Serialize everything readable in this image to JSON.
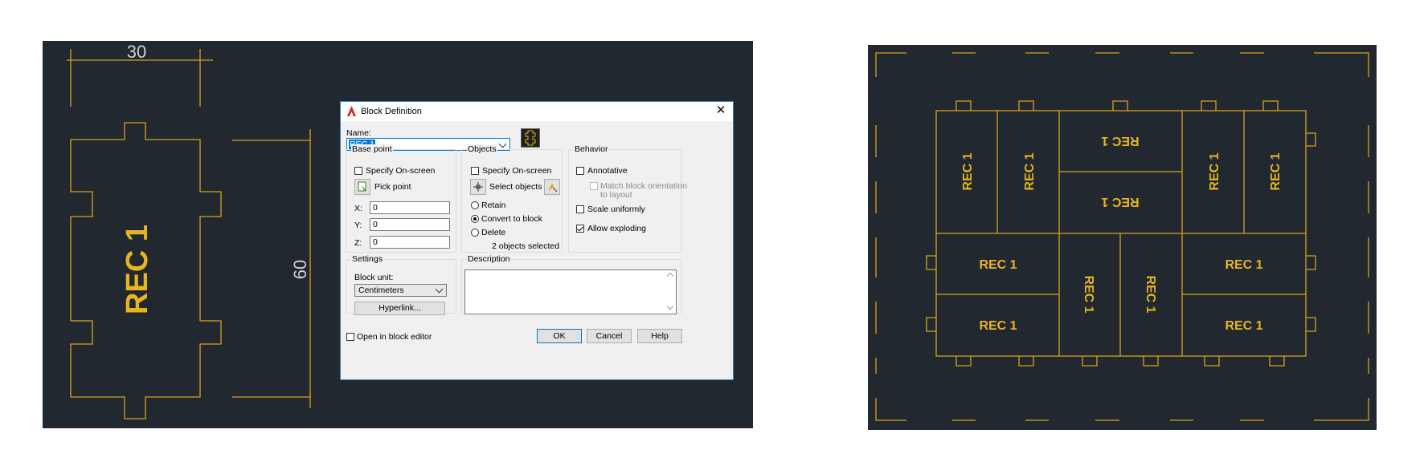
{
  "drawing_left": {
    "dim_width": "30",
    "dim_height": "60",
    "block_label": "REC 1"
  },
  "drawing_right": {
    "block_label": "REC 1"
  },
  "dialog": {
    "title": "Block Definition",
    "name_label": "Name:",
    "name_value": "REC 1",
    "base_point": {
      "title": "Base point",
      "specify_onscreen": "Specify On-screen",
      "pick_point": "Pick point",
      "x_label": "X:",
      "x_value": "0",
      "y_label": "Y:",
      "y_value": "0",
      "z_label": "Z:",
      "z_value": "0"
    },
    "objects": {
      "title": "Objects",
      "specify_onscreen": "Specify On-screen",
      "select_objects": "Select objects",
      "retain": "Retain",
      "convert": "Convert to block",
      "delete": "Delete",
      "selected_count": "2 objects selected"
    },
    "behavior": {
      "title": "Behavior",
      "annotative": "Annotative",
      "match_orientation_1": "Match block orientation",
      "match_orientation_2": "to layout",
      "scale_uniformly": "Scale uniformly",
      "allow_exploding": "Allow exploding"
    },
    "settings": {
      "title": "Settings",
      "block_unit_label": "Block unit:",
      "block_unit_value": "Centimeters",
      "hyperlink": "Hyperlink..."
    },
    "description": {
      "title": "Description",
      "value": ""
    },
    "open_in_editor": "Open in block editor",
    "ok": "OK",
    "cancel": "Cancel",
    "help": "Help"
  },
  "colors": {
    "cad_bg": "#212830",
    "cad_line": "#d9a21a",
    "accent": "#0078d7"
  }
}
